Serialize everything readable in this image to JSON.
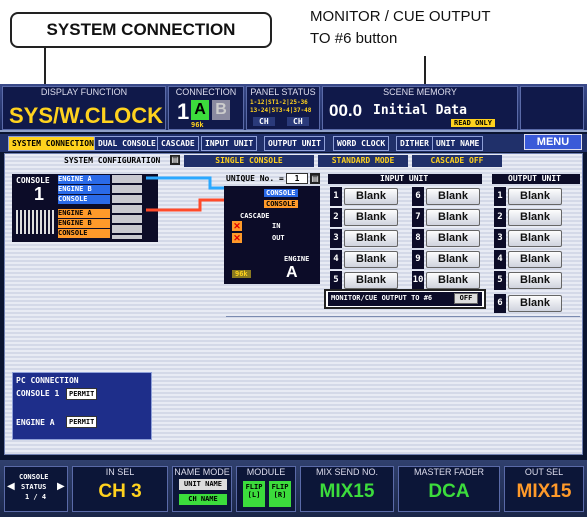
{
  "annotations": {
    "callout_left": "SYSTEM CONNECTION",
    "callout_right_line1": "MONITOR / CUE OUTPUT",
    "callout_right_line2": "TO #6 button"
  },
  "header": {
    "display_function_label": "DISPLAY FUNCTION",
    "display_function_value": "SYS/W.CLOCK",
    "connection_label": "CONNECTION",
    "connection_num": "1",
    "connection_a": "A",
    "connection_b": "B",
    "connection_sub": "96k",
    "panel_status_label": "PANEL STATUS",
    "panel_status_line1": "1-12|ST1-2|25-36",
    "panel_status_line2": "13-24|ST3-4|37-48",
    "panel_ch1": "CH",
    "panel_ch2": "CH",
    "scene_memory_label": "SCENE MEMORY",
    "scene_num": "00.0",
    "scene_name": "Initial Data",
    "read_only": "READ ONLY",
    "menu": "MENU"
  },
  "tabs": [
    "SYSTEM CONNECTION",
    "DUAL CONSOLE",
    "CASCADE",
    "INPUT UNIT",
    "OUTPUT UNIT",
    "WORD CLOCK",
    "DITHER",
    "UNIT NAME"
  ],
  "config": {
    "label": "SYSTEM CONFIGURATION",
    "mode1": "SINGLE CONSOLE",
    "mode2": "STANDARD MODE",
    "mode3": "CASCADE OFF"
  },
  "console": {
    "label": "CONSOLE",
    "number": "1",
    "rows_top": [
      "ENGINE A",
      "ENGINE B",
      "CONSOLE"
    ],
    "rows_bottom": [
      "ENGINE A",
      "ENGINE B",
      "CONSOLE"
    ]
  },
  "engine": {
    "unique_label": "UNIQUE No. =",
    "unique_value": "1",
    "console1": "CONSOLE",
    "console2": "CONSOLE",
    "cascade_label": "CASCADE",
    "cascade_in": "IN",
    "cascade_out": "OUT",
    "engine_label": "ENGINE",
    "engine_letter": "A",
    "engine_rate": "96k"
  },
  "input_unit": {
    "header": "INPUT UNIT",
    "slots": [
      {
        "num": "1",
        "label": "Blank"
      },
      {
        "num": "2",
        "label": "Blank"
      },
      {
        "num": "3",
        "label": "Blank"
      },
      {
        "num": "4",
        "label": "Blank"
      },
      {
        "num": "5",
        "label": "Blank"
      },
      {
        "num": "6",
        "label": "Blank"
      },
      {
        "num": "7",
        "label": "Blank"
      },
      {
        "num": "8",
        "label": "Blank"
      },
      {
        "num": "9",
        "label": "Blank"
      },
      {
        "num": "10",
        "label": "Blank"
      }
    ]
  },
  "output_unit": {
    "header": "OUTPUT UNIT",
    "slots": [
      {
        "num": "1",
        "label": "Blank"
      },
      {
        "num": "2",
        "label": "Blank"
      },
      {
        "num": "3",
        "label": "Blank"
      },
      {
        "num": "4",
        "label": "Blank"
      },
      {
        "num": "5",
        "label": "Blank"
      },
      {
        "num": "6",
        "label": "Blank"
      }
    ]
  },
  "monitor": {
    "label": "MONITOR/CUE OUTPUT TO #6",
    "state": "OFF"
  },
  "pc_connection": {
    "title": "PC CONNECTION",
    "console_label": "CONSOLE 1",
    "console_btn": "PERMIT",
    "engine_label": "ENGINE A",
    "engine_btn": "PERMIT"
  },
  "footer": {
    "console_status_line1": "CONSOLE",
    "console_status_line2": "STATUS",
    "console_status_page": "1 / 4",
    "in_sel_label": "IN SEL",
    "in_sel_value": "CH 3",
    "name_mode_label": "NAME MODE",
    "name_mode_btn": "UNIT NAME",
    "name_mode_sub": "CH NAME",
    "module_label": "MODULE",
    "flip_l_line1": "FLIP",
    "flip_l_line2": "[L]",
    "flip_r_line1": "FLIP",
    "flip_r_line2": "[R]",
    "mix_send_label": "MIX SEND NO.",
    "mix_send_value": "MIX15",
    "master_fader_label": "MASTER FADER",
    "master_fader_value": "DCA",
    "out_sel_label": "OUT SEL",
    "out_sel_value": "MIX15"
  },
  "colors": {
    "accent_yellow": "#ffd21e",
    "green": "#3cdc3c",
    "orange": "#ff9a2a",
    "blue_cable": "#2aa8ff",
    "red_cable": "#ff4a2a"
  }
}
